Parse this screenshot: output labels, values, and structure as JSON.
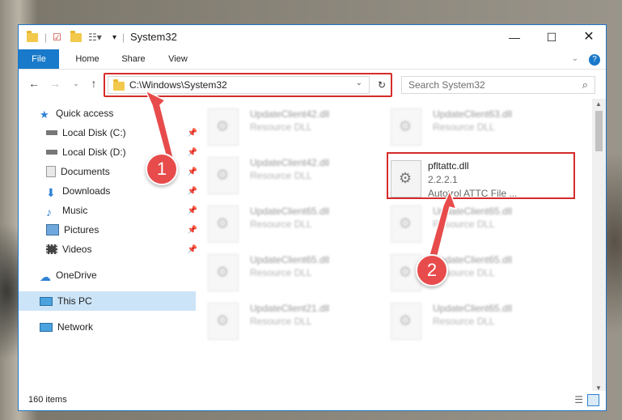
{
  "window": {
    "title": "System32"
  },
  "ribbon": {
    "tabs": [
      "File",
      "Home",
      "Share",
      "View"
    ]
  },
  "address": {
    "path": "C:\\Windows\\System32"
  },
  "search": {
    "placeholder": "Search System32"
  },
  "sidebar": {
    "items": [
      {
        "label": "Quick access"
      },
      {
        "label": "Local Disk (C:)"
      },
      {
        "label": "Local Disk (D:)"
      },
      {
        "label": "Documents"
      },
      {
        "label": "Downloads"
      },
      {
        "label": "Music"
      },
      {
        "label": "Pictures"
      },
      {
        "label": "Videos"
      },
      {
        "label": "OneDrive"
      },
      {
        "label": "This PC"
      },
      {
        "label": "Network"
      }
    ]
  },
  "files": [
    {
      "name": "UpdateClient42.dll",
      "desc": "Resource DLL"
    },
    {
      "name": "UpdateClient63.dll",
      "desc": "Resource DLL"
    },
    {
      "name": "UpdateClient42.dll",
      "desc": "Resource DLL"
    },
    {
      "name": "UpdateClient65.dll",
      "desc": "Resource DLL"
    },
    {
      "name": "UpdateClient65.dll",
      "desc": "Resource DLL"
    },
    {
      "name": "UpdateClient65.dll",
      "desc": "Resource DLL"
    },
    {
      "name": "UpdateClient65.dll",
      "desc": "Resource DLL"
    },
    {
      "name": "UpdateClient21.dll",
      "desc": "Resource DLL"
    },
    {
      "name": "UpdateClient65.dll",
      "desc": "Resource DLL"
    }
  ],
  "target_file": {
    "name": "pfltattc.dll",
    "version": "2.2.2.1",
    "desc": "Autotrol ATTC File ..."
  },
  "annotations": {
    "step1": "1",
    "step2": "2"
  },
  "status": {
    "items": "160 items"
  },
  "colors": {
    "accent": "#1979ca",
    "highlight": "#d62b2b",
    "badge": "#e84b4b"
  }
}
